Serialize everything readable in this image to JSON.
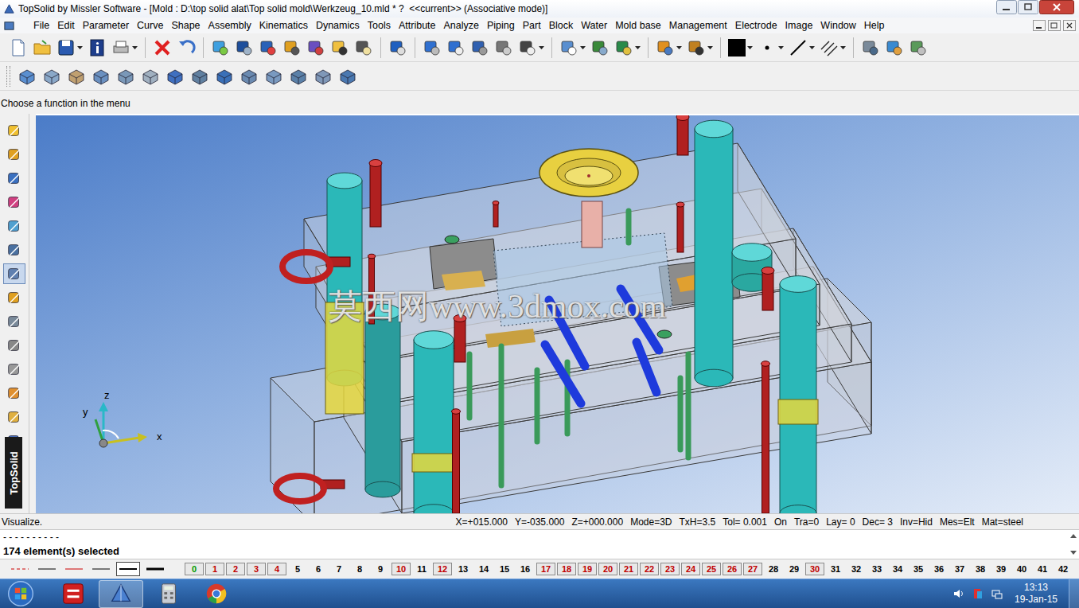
{
  "window": {
    "title": "TopSolid by Missler Software - [Mold : D:\\top solid alat\\Top solid mold\\Werkzeug_10.mld * ?  <<current>> (Associative mode)]"
  },
  "menu": [
    "File",
    "Edit",
    "Parameter",
    "Curve",
    "Shape",
    "Assembly",
    "Kinematics",
    "Dynamics",
    "Tools",
    "Attribute",
    "Analyze",
    "Piping",
    "Part",
    "Block",
    "Water",
    "Mold base",
    "Management",
    "Electrode",
    "Image",
    "Window",
    "Help"
  ],
  "current_color": "#000000",
  "prompt": "Choose a function in the menu",
  "side_tools": [
    {
      "selected": false
    },
    {
      "selected": false
    },
    {
      "selected": false
    },
    {
      "selected": false
    },
    {
      "selected": false
    },
    {
      "selected": false
    },
    {
      "selected": true
    },
    {
      "selected": false
    },
    {
      "selected": false
    },
    {
      "selected": false
    },
    {
      "selected": false
    },
    {
      "selected": false
    },
    {
      "selected": false
    },
    {
      "selected": false
    }
  ],
  "side_label": "TopSolid",
  "viewport": {
    "watermark": "莫西网www.3dmox.com",
    "axes": {
      "z": "z",
      "y": "y",
      "x": "x"
    }
  },
  "status_bar": {
    "message": "Visualize.",
    "fields": [
      "X=+015.000",
      "Y=-035.000",
      "Z=+000.000",
      "Mode=3D",
      "TxH=3.5",
      "Tol= 0.001",
      "On",
      "Tra=0",
      "Lay= 0",
      "Dec= 3",
      "Inv=Hid",
      "Mes=Elt",
      "Mat=steel"
    ]
  },
  "messages": [
    {
      "text": "- - - - - - - - - -",
      "kind": "separator"
    },
    {
      "text": "174 element(s) selected",
      "kind": "result"
    }
  ],
  "line_styles": [
    {
      "kind": "dash",
      "color": "#cc0000",
      "selected": false
    },
    {
      "kind": "thin",
      "color": "#000000",
      "selected": false
    },
    {
      "kind": "thin",
      "color": "#cc0000",
      "selected": false
    },
    {
      "kind": "thin",
      "color": "#000000",
      "selected": false
    },
    {
      "kind": "medium",
      "color": "#000000",
      "selected": true
    },
    {
      "kind": "thick",
      "color": "#000000",
      "selected": false
    }
  ],
  "layers": [
    {
      "label": "0",
      "used": true,
      "current": true
    },
    {
      "label": "1",
      "used": true,
      "current": false
    },
    {
      "label": "2",
      "used": true,
      "current": false
    },
    {
      "label": "3",
      "used": true,
      "current": false
    },
    {
      "label": "4",
      "used": true,
      "current": false
    },
    {
      "label": "5",
      "used": false,
      "current": false
    },
    {
      "label": "6",
      "used": false,
      "current": false
    },
    {
      "label": "7",
      "used": false,
      "current": false
    },
    {
      "label": "8",
      "used": false,
      "current": false
    },
    {
      "label": "9",
      "used": false,
      "current": false
    },
    {
      "label": "10",
      "used": true,
      "current": false
    },
    {
      "label": "11",
      "used": false,
      "current": false
    },
    {
      "label": "12",
      "used": true,
      "current": false
    },
    {
      "label": "13",
      "used": false,
      "current": false
    },
    {
      "label": "14",
      "used": false,
      "current": false
    },
    {
      "label": "15",
      "used": false,
      "current": false
    },
    {
      "label": "16",
      "used": false,
      "current": false
    },
    {
      "label": "17",
      "used": true,
      "current": false
    },
    {
      "label": "18",
      "used": true,
      "current": false
    },
    {
      "label": "19",
      "used": true,
      "current": false
    },
    {
      "label": "20",
      "used": true,
      "current": false
    },
    {
      "label": "21",
      "used": true,
      "current": false
    },
    {
      "label": "22",
      "used": true,
      "current": false
    },
    {
      "label": "23",
      "used": true,
      "current": false
    },
    {
      "label": "24",
      "used": true,
      "current": false
    },
    {
      "label": "25",
      "used": true,
      "current": false
    },
    {
      "label": "26",
      "used": true,
      "current": false
    },
    {
      "label": "27",
      "used": true,
      "current": false
    },
    {
      "label": "28",
      "used": false,
      "current": false
    },
    {
      "label": "29",
      "used": false,
      "current": false
    },
    {
      "label": "30",
      "used": true,
      "current": false
    },
    {
      "label": "31",
      "used": false,
      "current": false
    },
    {
      "label": "32",
      "used": false,
      "current": false
    },
    {
      "label": "33",
      "used": false,
      "current": false
    },
    {
      "label": "34",
      "used": false,
      "current": false
    },
    {
      "label": "35",
      "used": false,
      "current": false
    },
    {
      "label": "36",
      "used": false,
      "current": false
    },
    {
      "label": "37",
      "used": false,
      "current": false
    },
    {
      "label": "38",
      "used": false,
      "current": false
    },
    {
      "label": "39",
      "used": false,
      "current": false
    },
    {
      "label": "40",
      "used": false,
      "current": false
    },
    {
      "label": "41",
      "used": false,
      "current": false
    },
    {
      "label": "42",
      "used": false,
      "current": false
    }
  ],
  "taskbar": {
    "time": "13:13",
    "date": "19-Jan-15"
  }
}
